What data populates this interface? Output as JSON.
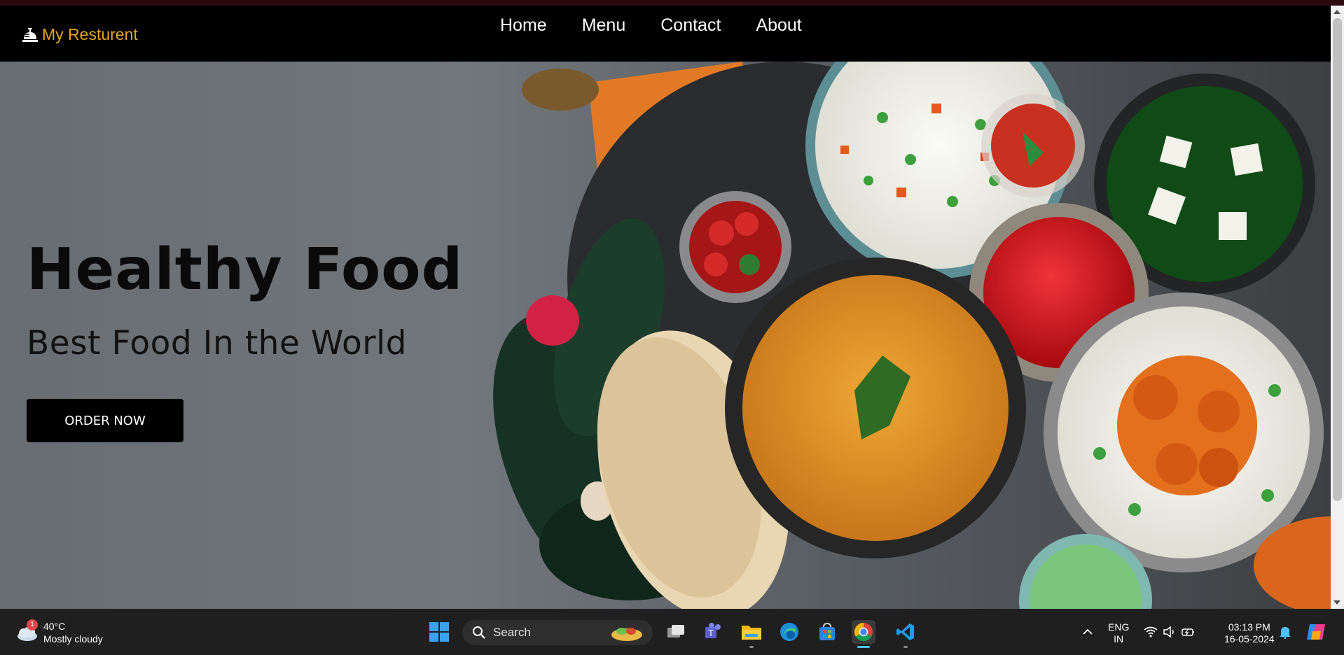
{
  "nav": {
    "brand": "My Resturent",
    "links": [
      "Home",
      "Menu",
      "Contact",
      "About"
    ]
  },
  "hero": {
    "title": "Healthy Food",
    "subtitle": "Best Food In the World",
    "cta": "ORDER NOW"
  },
  "taskbar": {
    "weather_temp": "40°C",
    "weather_desc": "Mostly cloudy",
    "weather_badge": "1",
    "search_label": "Search",
    "lang_top": "ENG",
    "lang_bottom": "IN",
    "time": "03:13 PM",
    "date": "16-05-2024"
  },
  "colors": {
    "brand": "#e7a51f",
    "navbar": "#000000",
    "taskbar": "#1f1f1f"
  }
}
